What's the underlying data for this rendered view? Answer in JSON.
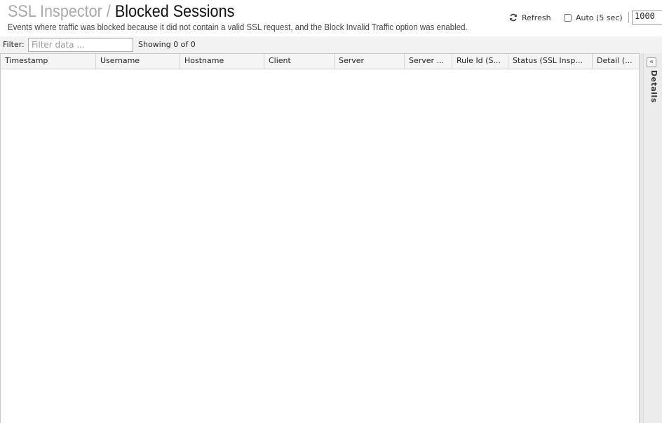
{
  "header": {
    "breadcrumb_parent": "SSL Inspector",
    "breadcrumb_separator": "/",
    "title": "Blocked Sessions",
    "subtitle": "Events where traffic was blocked because it did not contain a valid SSL request, and the Block Invalid Traffic option was enabled."
  },
  "toolbar": {
    "refresh_label": "Refresh",
    "auto_refresh_label": "Auto (5 sec)",
    "auto_refresh_checked": false,
    "limit_value": "1000"
  },
  "filter": {
    "label": "Filter:",
    "placeholder": "Filter data ...",
    "value": "",
    "showing_text": "Showing 0 of 0"
  },
  "grid": {
    "columns": [
      "Timestamp",
      "Username",
      "Hostname",
      "Client",
      "Server",
      "Server ...",
      "Rule Id (S...",
      "Status (SSL Insp...",
      "Detail (..."
    ],
    "rows": []
  },
  "details_panel": {
    "label": "Details",
    "collapse_glyph": "«"
  }
}
